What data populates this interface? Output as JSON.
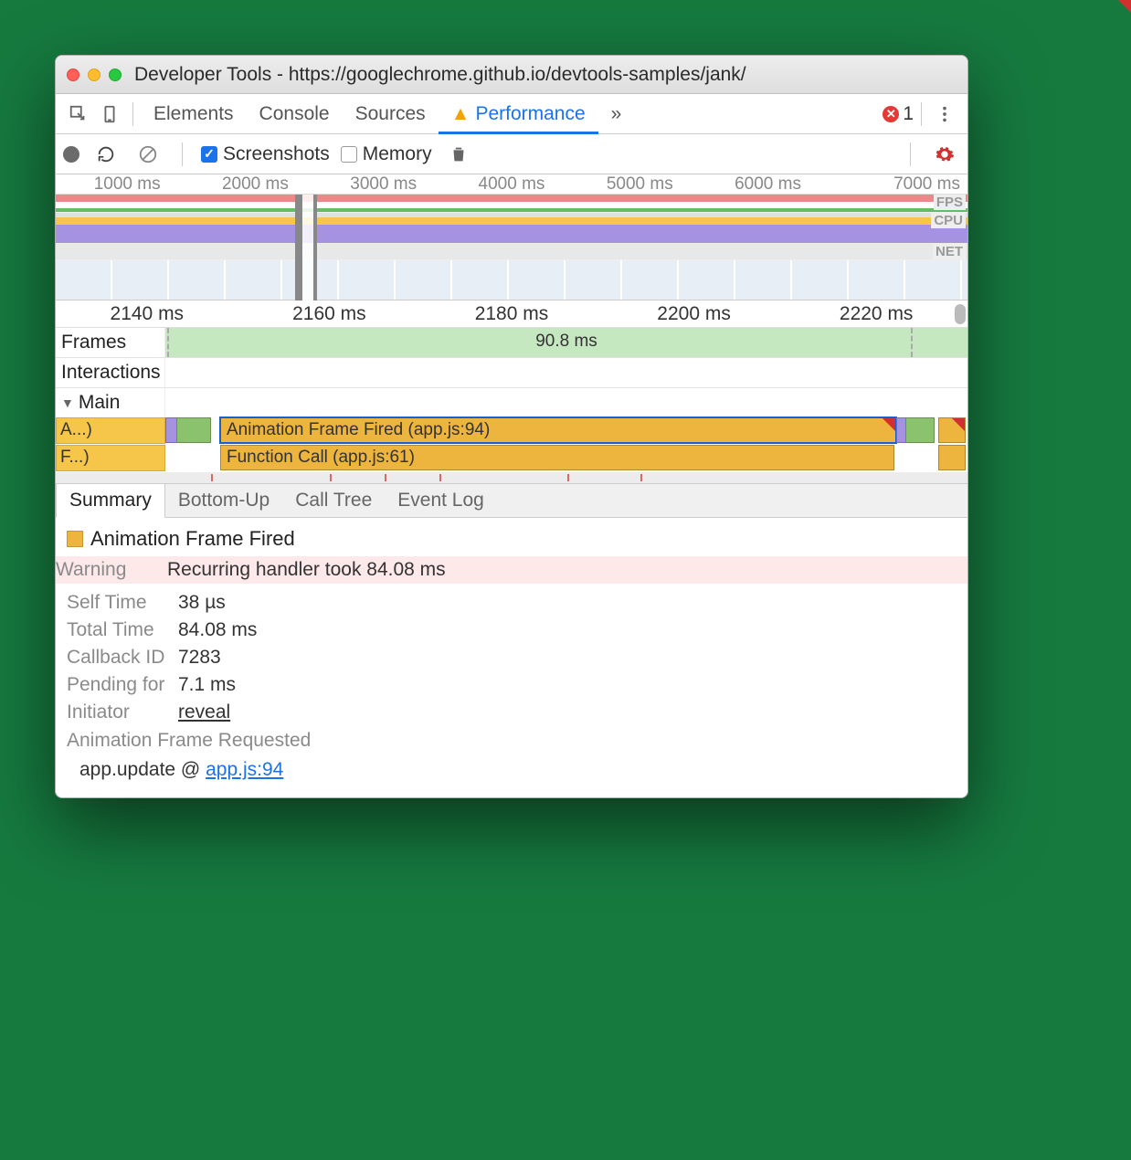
{
  "window": {
    "title": "Developer Tools - https://googlechrome.github.io/devtools-samples/jank/"
  },
  "tabs": {
    "elements": "Elements",
    "console": "Console",
    "sources": "Sources",
    "performance": "Performance",
    "more": "»",
    "error_count": "1"
  },
  "controls": {
    "screenshots": "Screenshots",
    "memory": "Memory"
  },
  "overview_ticks": [
    "1000 ms",
    "2000 ms",
    "3000 ms",
    "4000 ms",
    "5000 ms",
    "6000 ms",
    "7000 ms"
  ],
  "overview_labels": {
    "fps": "FPS",
    "cpu": "CPU",
    "net": "NET"
  },
  "zoom_ticks": [
    "2140 ms",
    "2160 ms",
    "2180 ms",
    "2200 ms",
    "2220 ms"
  ],
  "tracks": {
    "frames": "Frames",
    "frames_value": "90.8 ms",
    "interactions": "Interactions",
    "main": "Main"
  },
  "flame": {
    "row1_left": "A...)",
    "row1_main": "Animation Frame Fired (app.js:94)",
    "row2_left": "F...)",
    "row2_main": "Function Call (app.js:61)"
  },
  "subtabs": [
    "Summary",
    "Bottom-Up",
    "Call Tree",
    "Event Log"
  ],
  "summary": {
    "event_name": "Animation Frame Fired",
    "warning_label": "Warning",
    "warning_text": "Recurring handler took 84.08 ms",
    "self_time_k": "Self Time",
    "self_time_v": "38 µs",
    "total_time_k": "Total Time",
    "total_time_v": "84.08 ms",
    "callback_id_k": "Callback ID",
    "callback_id_v": "7283",
    "pending_k": "Pending for",
    "pending_v": "7.1 ms",
    "initiator_k": "Initiator",
    "initiator_v": "reveal",
    "afr": "Animation Frame Requested",
    "stack_fn": "app.update @ ",
    "stack_link": "app.js:94"
  }
}
